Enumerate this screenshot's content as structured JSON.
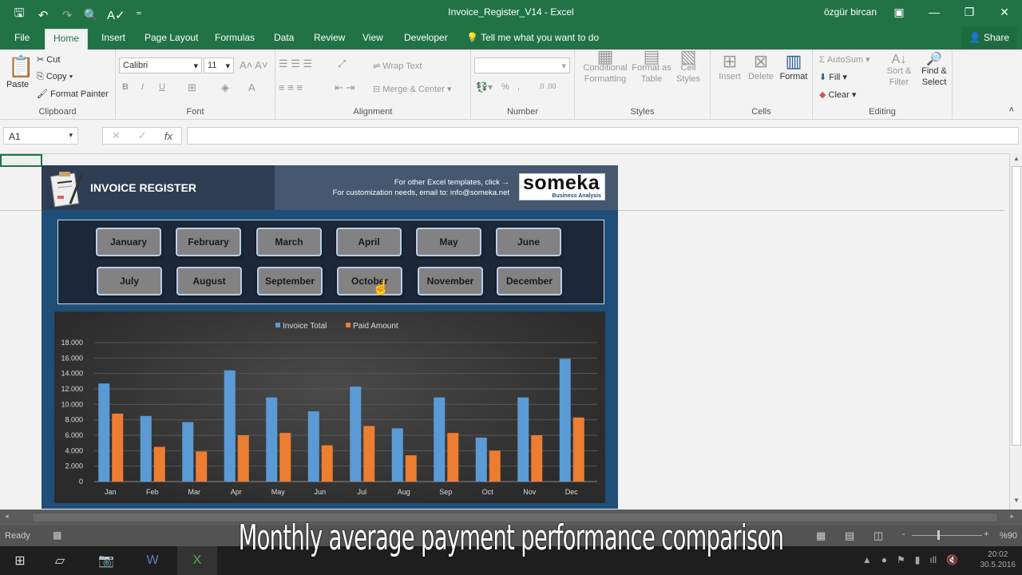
{
  "window": {
    "title": "Invoice_Register_V14 - Excel",
    "user": "özgür bircan",
    "controls": {
      "ribbon_display": "▣",
      "minimize": "—",
      "restore": "❐",
      "close": "✕"
    }
  },
  "qat": {
    "save": "🖫",
    "undo": "↶",
    "redo": "↷",
    "print_preview": "🔍",
    "spelling": "A✓",
    "customize": "⁼"
  },
  "tabs": [
    {
      "label": "File"
    },
    {
      "label": "Home"
    },
    {
      "label": "Insert"
    },
    {
      "label": "Page Layout"
    },
    {
      "label": "Formulas"
    },
    {
      "label": "Data"
    },
    {
      "label": "Review"
    },
    {
      "label": "View"
    },
    {
      "label": "Developer"
    }
  ],
  "tell_me": "Tell me what you want to do",
  "share_label": "Share",
  "ribbon": {
    "clipboard": {
      "label": "Clipboard",
      "paste": "Paste",
      "cut": "Cut",
      "copy": "Copy",
      "format_painter": "Format Painter"
    },
    "font": {
      "label": "Font",
      "name": "Calibri",
      "size": "11",
      "bold": "B",
      "italic": "I",
      "underline": "U"
    },
    "alignment": {
      "label": "Alignment",
      "wrap_text": "Wrap Text",
      "merge_center": "Merge & Center"
    },
    "number": {
      "label": "Number",
      "format": "",
      "percent": "%",
      "comma": ","
    },
    "styles": {
      "label": "Styles",
      "conditional_formatting": "Conditional Formatting",
      "format_as_table": "Format as Table",
      "cell_styles": "Cell Styles"
    },
    "cells": {
      "label": "Cells",
      "insert": "Insert",
      "delete": "Delete",
      "format": "Format"
    },
    "editing": {
      "label": "Editing",
      "autosum": "AutoSum",
      "fill": "Fill",
      "clear": "Clear",
      "sort_filter": "Sort & Filter",
      "find_select": "Find & Select"
    }
  },
  "formula_bar": {
    "name_box": "A1",
    "cancel": "✕",
    "enter": "✓",
    "fx": "fx",
    "value": ""
  },
  "dashboard": {
    "title": "INVOICE REGISTER",
    "info_line1": "For other Excel templates, click →",
    "info_line2": "For customization needs, email to: info@someka.net",
    "brand": "someka",
    "brand_tagline": "Business Analysis",
    "months": [
      "January",
      "February",
      "March",
      "April",
      "May",
      "June",
      "July",
      "August",
      "September",
      "October",
      "November",
      "December"
    ]
  },
  "chart_data": {
    "type": "bar",
    "title": "",
    "categories": [
      "Jan",
      "Feb",
      "Mar",
      "Apr",
      "May",
      "Jun",
      "Jul",
      "Aug",
      "Sep",
      "Oct",
      "Nov",
      "Dec"
    ],
    "series": [
      {
        "name": "Invoice Total",
        "color": "#5b9bd5",
        "values": [
          12700,
          8500,
          7700,
          14400,
          10900,
          9100,
          12300,
          6900,
          10900,
          5700,
          10900,
          15900
        ]
      },
      {
        "name": "Paid Amount",
        "color": "#ed7d31",
        "values": [
          8800,
          4500,
          3900,
          6000,
          6300,
          4700,
          7200,
          3400,
          6300,
          4000,
          6000,
          8300
        ]
      }
    ],
    "yticks": [
      "0",
      "2.000",
      "4.000",
      "6.000",
      "8.000",
      "10.000",
      "12.000",
      "14.000",
      "16.000",
      "18.000"
    ],
    "ylim": [
      0,
      18000
    ],
    "legend": "top-center",
    "grid": true,
    "xlabel": "",
    "ylabel": ""
  },
  "status": {
    "ready": "Ready",
    "zoom": "%90",
    "zoom_minus": "-",
    "zoom_plus": "+"
  },
  "caption": "Monthly average payment performance comparison",
  "taskbar": {
    "time": "20:02",
    "date": "30.5.2016"
  }
}
